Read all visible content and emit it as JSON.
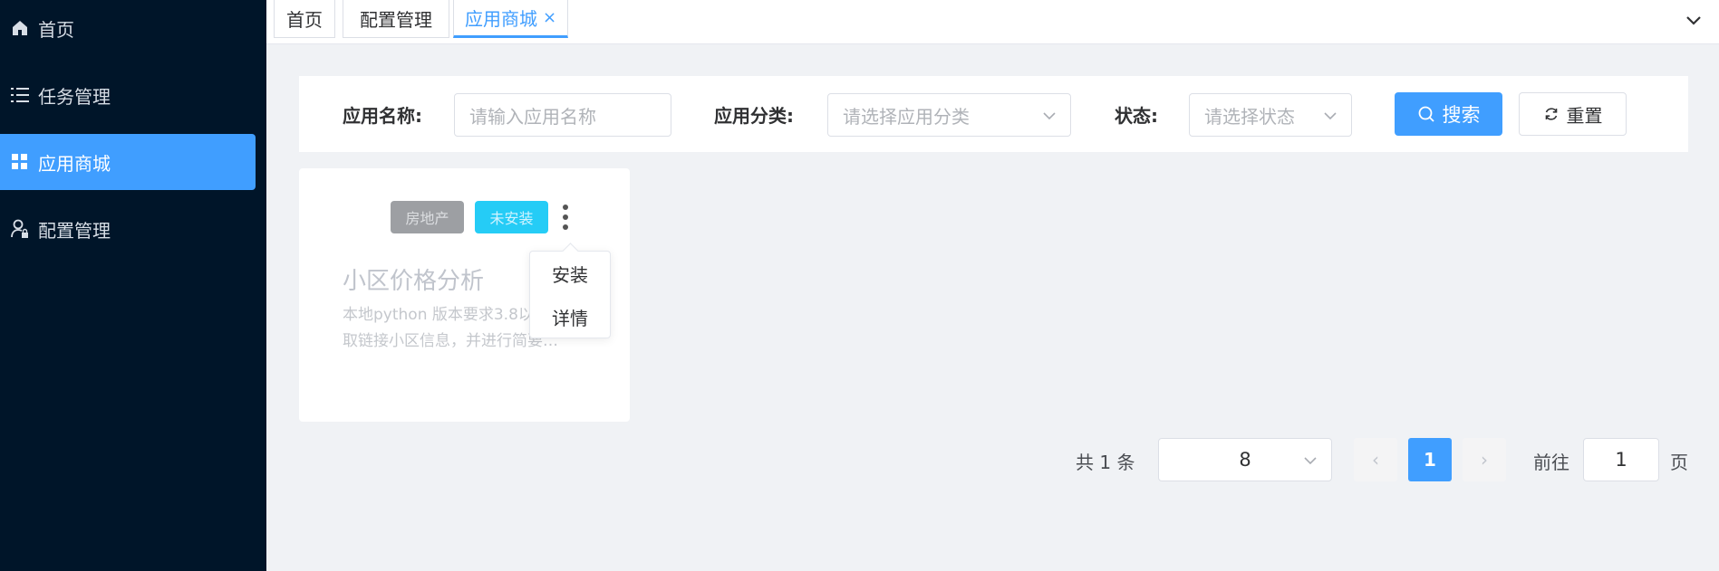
{
  "sidebar": {
    "items": [
      {
        "label": "首页",
        "icon": "home-icon",
        "active": false
      },
      {
        "label": "任务管理",
        "icon": "list-icon",
        "active": false
      },
      {
        "label": "应用商城",
        "icon": "grid-icon",
        "active": true
      },
      {
        "label": "配置管理",
        "icon": "user-lock-icon",
        "active": false
      }
    ],
    "bg_color": "#001529",
    "active_color": "#409eff"
  },
  "tabs": [
    {
      "label": "首页",
      "active": false
    },
    {
      "label": "配置管理",
      "active": false
    },
    {
      "label": "应用商城",
      "active": true,
      "close": "×"
    }
  ],
  "search": {
    "name_label": "应用名称:",
    "name_placeholder": "请输入应用名称",
    "category_label": "应用分类:",
    "category_placeholder": "请选择应用分类",
    "status_label": "状态:",
    "status_placeholder": "请选择状态",
    "search_button": "搜索",
    "reset_button": "重置"
  },
  "cards": [
    {
      "category_tag": "房地产",
      "status_tag": "未安装",
      "title": "小区价格分析",
      "description_lines": [
        "本地python 版本要求3.8以",
        "取链接小区信息，并进行简要…"
      ]
    }
  ],
  "card_menu": {
    "items": [
      "安装",
      "详情"
    ]
  },
  "pagination": {
    "total_text": "共 1 条",
    "page_size": "8",
    "current_page": "1",
    "prev": "‹",
    "next": "›",
    "goto_label": "前往",
    "goto_value": "1",
    "page_suffix": "页"
  }
}
